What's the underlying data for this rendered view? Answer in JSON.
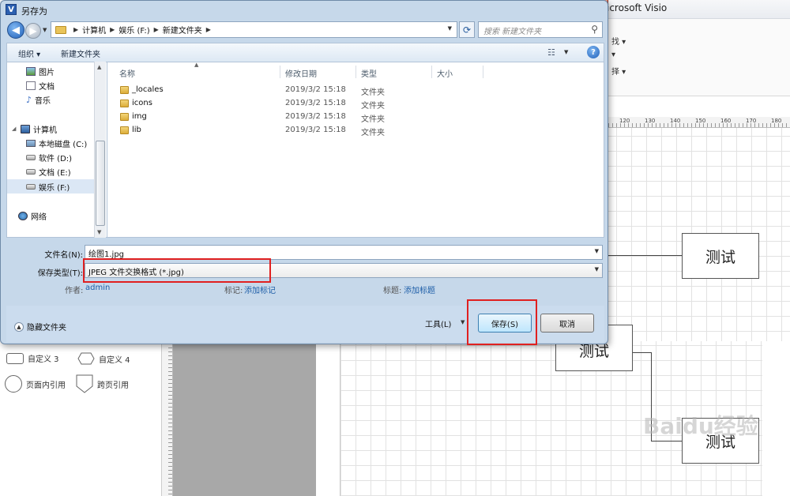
{
  "visio": {
    "title": "icrosoft Visio",
    "ribbon_fragments": [
      "找 ▾",
      "▾",
      "择 ▾"
    ],
    "ruler_numbers": [
      "120",
      "130",
      "140",
      "150",
      "160",
      "170",
      "180"
    ],
    "shapes": [
      "自定义 3",
      "自定义 4",
      "页面内引用",
      "跨页引用"
    ],
    "flowchart_boxes": [
      "测试",
      "测试",
      "测试"
    ],
    "watermark": "Baidu经验"
  },
  "dialog": {
    "title": "另存为",
    "app_icon_letter": "V",
    "breadcrumbs": [
      "计算机",
      "娱乐 (F:)",
      "新建文件夹"
    ],
    "search_placeholder": "搜索 新建文件夹",
    "toolbar": {
      "organize": "组织 ▾",
      "new_folder": "新建文件夹"
    },
    "nav_items": [
      {
        "label": "图片"
      },
      {
        "label": "文档"
      },
      {
        "label": "音乐"
      },
      {
        "label": "计算机"
      },
      {
        "label": "本地磁盘 (C:)"
      },
      {
        "label": "软件 (D:)"
      },
      {
        "label": "文档 (E:)"
      },
      {
        "label": "娱乐 (F:)"
      },
      {
        "label": "网络"
      }
    ],
    "columns": {
      "name": "名称",
      "date": "修改日期",
      "type": "类型",
      "size": "大小"
    },
    "files": [
      {
        "name": "_locales",
        "date": "2019/3/2 15:18",
        "type": "文件夹"
      },
      {
        "name": "icons",
        "date": "2019/3/2 15:18",
        "type": "文件夹"
      },
      {
        "name": "img",
        "date": "2019/3/2 15:18",
        "type": "文件夹"
      },
      {
        "name": "lib",
        "date": "2019/3/2 15:18",
        "type": "文件夹"
      }
    ],
    "filename_label": "文件名(N):",
    "filename_value": "绘图1.jpg",
    "filetype_label": "保存类型(T):",
    "filetype_value": "JPEG 文件交换格式 (*.jpg)",
    "author_label": "作者:",
    "author_value": "admin",
    "tags_label": "标记:",
    "tags_value": "添加标记",
    "titlefield_label": "标题:",
    "titlefield_value": "添加标题",
    "hide_folders": "隐藏文件夹",
    "tools_label": "工具(L)",
    "save_label": "保存(S)",
    "cancel_label": "取消"
  },
  "colors": {
    "highlight_box": "#e02020",
    "dialog_frame": "#c6d8ea",
    "link": "#1f5fa8"
  }
}
